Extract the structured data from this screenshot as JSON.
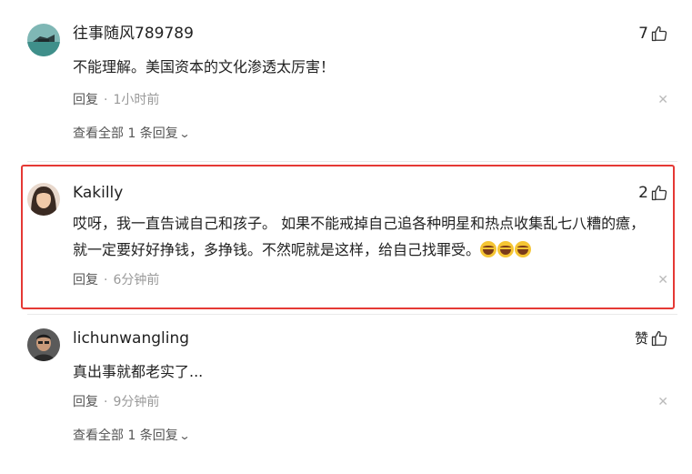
{
  "comments": [
    {
      "username": "往事随风789789",
      "likes": "7",
      "text": "不能理解。美国资本的文化渗透太厉害！",
      "reply_label": "回复",
      "separator": "·",
      "time": "1小时前",
      "view_all": "查看全部 1 条回复",
      "highlighted": false
    },
    {
      "username": "Kakilly",
      "likes": "2",
      "text": "哎呀，我一直告诫自己和孩子。 如果不能戒掉自己追各种明星和热点收集乱七八糟的癔，就一定要好好挣钱，多挣钱。不然呢就是这样，给自己找罪受。",
      "emoji_count": 3,
      "reply_label": "回复",
      "separator": "·",
      "time": "6分钟前",
      "highlighted": true,
      "highlight_color": "#e53935"
    },
    {
      "username": "lichunwangling",
      "likes": "赞",
      "text": "真出事就都老实了...",
      "reply_label": "回复",
      "separator": "·",
      "time": "9分钟前",
      "view_all": "查看全部 1 条回复",
      "highlighted": false
    }
  ],
  "icons": {
    "like": "thumbs-up-icon",
    "close": "close-icon",
    "chevron": "chevron-down-icon"
  },
  "glyphs": {
    "close": "✕",
    "chevron": "⌄"
  }
}
